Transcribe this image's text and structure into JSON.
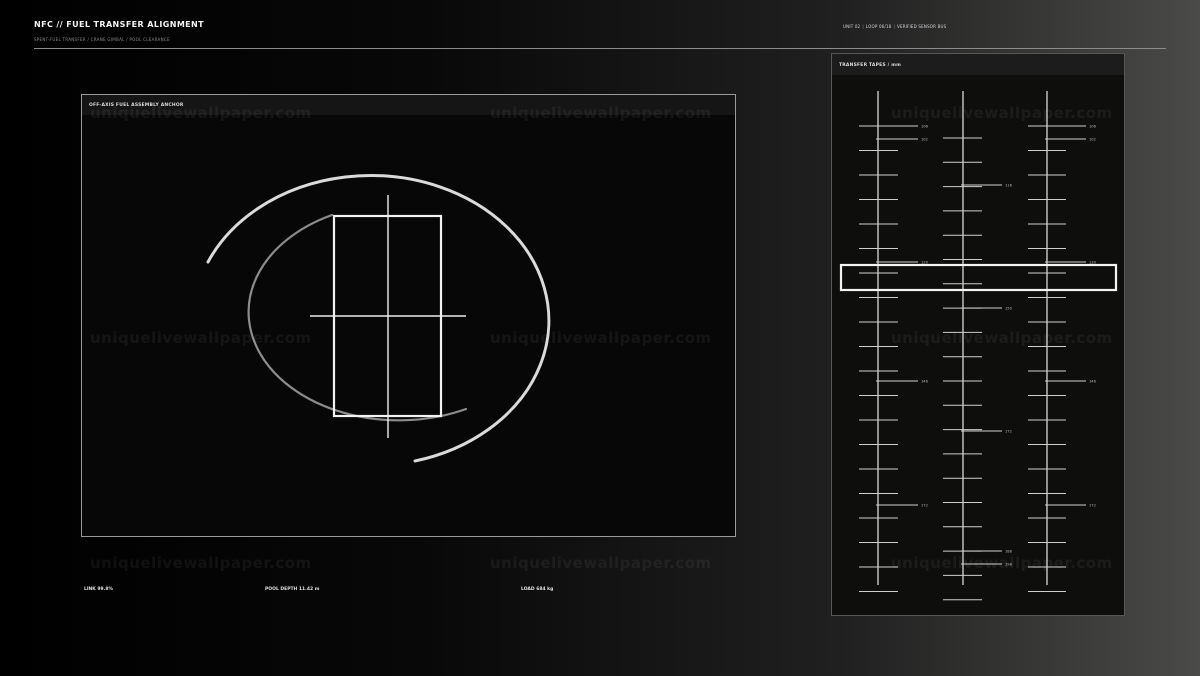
{
  "header": {
    "title": "NFC // FUEL TRANSFER ALIGNMENT",
    "subtitle": "SPENT-FUEL TRANSFER / CRANE GIMBAL / POOL CLEARANCE",
    "status": [
      "UNIT 02",
      "LOOP 06/18",
      "VERIFIED SENSOR BUS"
    ]
  },
  "anchor_panel": {
    "title": "OFF-AXIS FUEL ASSEMBLY ANCHOR"
  },
  "tape_panel": {
    "title": "TRANSFER TAPES / mm",
    "tapes": [
      {
        "labels": [
          "106",
          "102",
          "120",
          "146",
          "172"
        ]
      },
      {
        "labels": [
          "116",
          "150",
          "172",
          "188",
          "198"
        ]
      },
      {
        "labels": [
          "106",
          "102",
          "130",
          "146",
          "172"
        ]
      }
    ]
  },
  "readouts": {
    "link": "LINK 99.8%",
    "pool_depth": "POOL DEPTH  11.42 m",
    "load": "LOAD  684 kg"
  },
  "watermark": "uniquelivewallpaper.com"
}
